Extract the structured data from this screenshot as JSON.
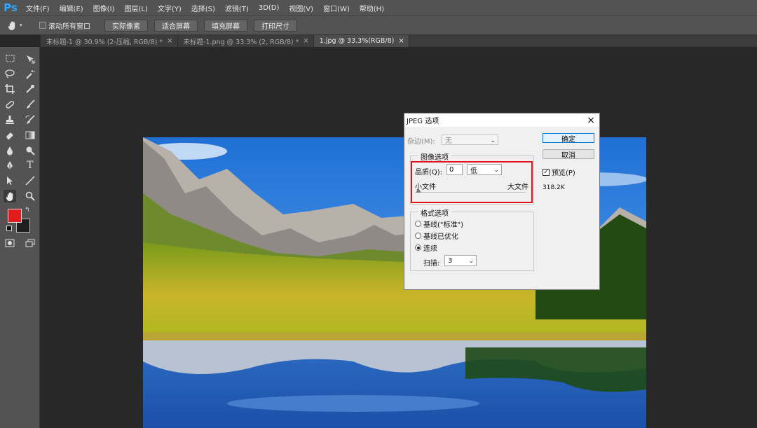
{
  "app": {
    "logo": "Ps"
  },
  "menu": [
    "文件(F)",
    "编辑(E)",
    "图像(I)",
    "图层(L)",
    "文字(Y)",
    "选择(S)",
    "滤镜(T)",
    "3D(D)",
    "视图(V)",
    "窗口(W)",
    "帮助(H)"
  ],
  "options_bar": {
    "scroll_all_label": "滚动所有窗口",
    "buttons": [
      "实际像素",
      "适合屏幕",
      "填充屏幕",
      "打印尺寸"
    ]
  },
  "tabs": [
    {
      "label": "未标题-1 @ 30.9% (2-压缩, RGB/8) *",
      "close": "×",
      "active": false
    },
    {
      "label": "未标题-1.png @ 33.3% (2, RGB/8) *",
      "close": "×",
      "active": false
    },
    {
      "label": "1.jpg @ 33.3%(RGB/8)",
      "close": "×",
      "active": true
    }
  ],
  "colors": {
    "foreground": "#e21b1b",
    "background": "#1e1e1e",
    "highlight": "#e0121b"
  },
  "tools": [
    [
      "marquee-icon",
      "move-icon"
    ],
    [
      "lasso-icon",
      "magic-wand-icon"
    ],
    [
      "crop-icon",
      "eyedropper-icon"
    ],
    [
      "healing-brush-icon",
      "brush-icon"
    ],
    [
      "clone-stamp-icon",
      "history-brush-icon"
    ],
    [
      "eraser-icon",
      "gradient-icon"
    ],
    [
      "blur-icon",
      "dodge-icon"
    ],
    [
      "pen-icon",
      "type-icon"
    ],
    [
      "path-select-icon",
      "line-icon"
    ],
    [
      "hand-icon",
      "zoom-icon"
    ]
  ],
  "dialog": {
    "title": "JPEG 选项",
    "close": "×",
    "matte_label": "杂边(M):",
    "matte_value": "无",
    "ok": "确定",
    "cancel": "取消",
    "preview_label": "预览(P)",
    "file_size": "318.2K",
    "image_options": {
      "title": "图像选项",
      "quality_label": "品质(Q):",
      "quality_value": "0",
      "quality_preset": "低",
      "small_file": "小文件",
      "large_file": "大文件",
      "slider_value": 0
    },
    "format_options": {
      "title": "格式选项",
      "options": [
        "基线(\"标准\")",
        "基线已优化",
        "连续"
      ],
      "selected_index": 2,
      "scans_label": "扫描:",
      "scans_value": "3"
    }
  }
}
